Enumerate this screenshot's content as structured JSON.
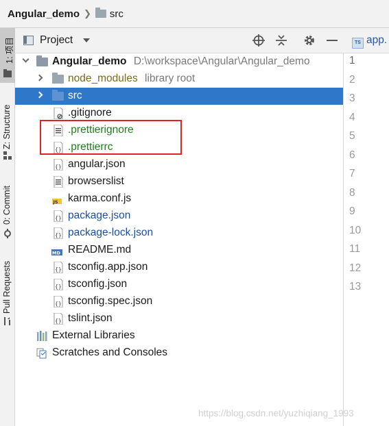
{
  "breadcrumb": {
    "project": "Angular_demo",
    "folder": "src"
  },
  "strip": {
    "tabs": [
      {
        "label": "1: 项目"
      },
      {
        "label": "Z: Structure"
      },
      {
        "label": "0: Commit"
      },
      {
        "label": "Pull Requests"
      }
    ]
  },
  "panel": {
    "title": "Project"
  },
  "tree": {
    "root": {
      "name": "Angular_demo",
      "path": "D:\\workspace\\Angular\\Angular_demo"
    },
    "node_modules": {
      "name": "node_modules",
      "hint": "library root"
    },
    "src": {
      "name": "src"
    },
    "files": [
      {
        "name": ".gitignore"
      },
      {
        "name": ".prettierignore"
      },
      {
        "name": ".prettierrc"
      },
      {
        "name": "angular.json"
      },
      {
        "name": "browserslist"
      },
      {
        "name": "karma.conf.js"
      },
      {
        "name": "package.json"
      },
      {
        "name": "package-lock.json"
      },
      {
        "name": "README.md"
      },
      {
        "name": "tsconfig.app.json"
      },
      {
        "name": "tsconfig.json"
      },
      {
        "name": "tsconfig.spec.json"
      },
      {
        "name": "tslint.json"
      }
    ],
    "external_libraries": "External Libraries",
    "scratches": "Scratches and Consoles"
  },
  "editor": {
    "tab": "app.",
    "line_numbers": [
      "1",
      "2",
      "3",
      "4",
      "5",
      "6",
      "7",
      "8",
      "9",
      "10",
      "11",
      "12",
      "13"
    ]
  },
  "watermark": "https://blog.csdn.net/yuzhiqiang_1993",
  "colors": {
    "selection": "#2f77c8",
    "highlight_box": "#e0202a",
    "new_file_green": "#1e7d1e",
    "json_blue": "#1a4fa0"
  }
}
